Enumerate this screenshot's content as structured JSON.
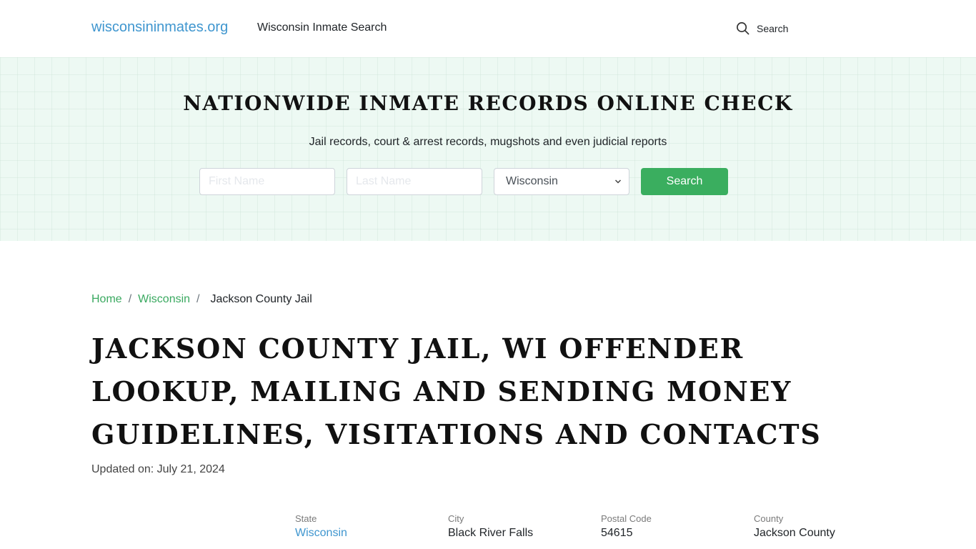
{
  "navbar": {
    "brand": "wisconsininmates.org",
    "link": "Wisconsin Inmate Search",
    "search_label": "Search",
    "search_icon": "search-icon"
  },
  "hero": {
    "title": "NATIONWIDE INMATE RECORDS ONLINE CHECK",
    "subtitle": "Jail records, court & arrest records, mugshots and even judicial reports",
    "first_name_placeholder": "First Name",
    "first_name_value": "",
    "last_name_placeholder": "Last Name",
    "last_name_value": "",
    "state_selected": "Wisconsin",
    "search_button": "Search",
    "button_color": "#3aae5f"
  },
  "breadcrumb": {
    "items": [
      {
        "label": "Home"
      },
      {
        "label": "Wisconsin"
      }
    ],
    "separator": "/",
    "current": "Jackson County Jail"
  },
  "page": {
    "title": "JACKSON COUNTY JAIL, WI OFFENDER LOOKUP, MAILING AND SENDING MONEY GUIDELINES, VISITATIONS AND CONTACTS",
    "updated": "Updated on: July 21, 2024"
  },
  "info": [
    {
      "label": "State",
      "value": "Wisconsin"
    },
    {
      "label": "City",
      "value": "Black River Falls"
    },
    {
      "label": "Postal Code",
      "value": "54615"
    },
    {
      "label": "County",
      "value": "Jackson County"
    }
  ]
}
